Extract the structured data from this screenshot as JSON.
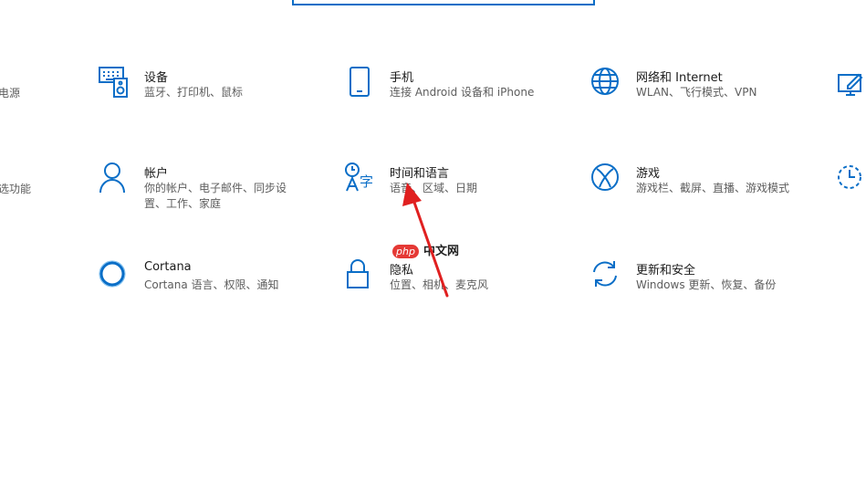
{
  "colors": {
    "accent": "#0a6ec7",
    "title": "#1a1a1a",
    "desc": "#5d5d5d",
    "arrow": "#e02020"
  },
  "left_partial": [
    {
      "icon": "",
      "desc": "电源"
    },
    {
      "icon": "",
      "desc": "选功能"
    }
  ],
  "tiles": [
    {
      "title": "设备",
      "desc": "蓝牙、打印机、鼠标",
      "icon": "keyboard-speaker-icon"
    },
    {
      "title": "手机",
      "desc": "连接 Android 设备和 iPhone",
      "icon": "phone-icon"
    },
    {
      "title": "网络和 Internet",
      "desc": "WLAN、飞行模式、VPN",
      "icon": "globe-icon"
    },
    {
      "title": "帐户",
      "desc": "你的帐户、电子邮件、同步设置、工作、家庭",
      "icon": "person-icon"
    },
    {
      "title": "时间和语言",
      "desc": "语音、区域、日期",
      "icon": "time-language-icon"
    },
    {
      "title": "游戏",
      "desc": "游戏栏、截屏、直播、游戏模式",
      "icon": "xbox-icon"
    },
    {
      "title": "Cortana",
      "desc": "Cortana 语言、权限、通知",
      "icon": "cortana-circle-icon"
    },
    {
      "title": "隐私",
      "desc": "位置、相机、麦克风",
      "icon": "lock-icon"
    },
    {
      "title": "更新和安全",
      "desc": "Windows 更新、恢复、备份",
      "icon": "refresh-icon"
    }
  ],
  "watermark": {
    "badge": "php",
    "text": "中文网"
  }
}
